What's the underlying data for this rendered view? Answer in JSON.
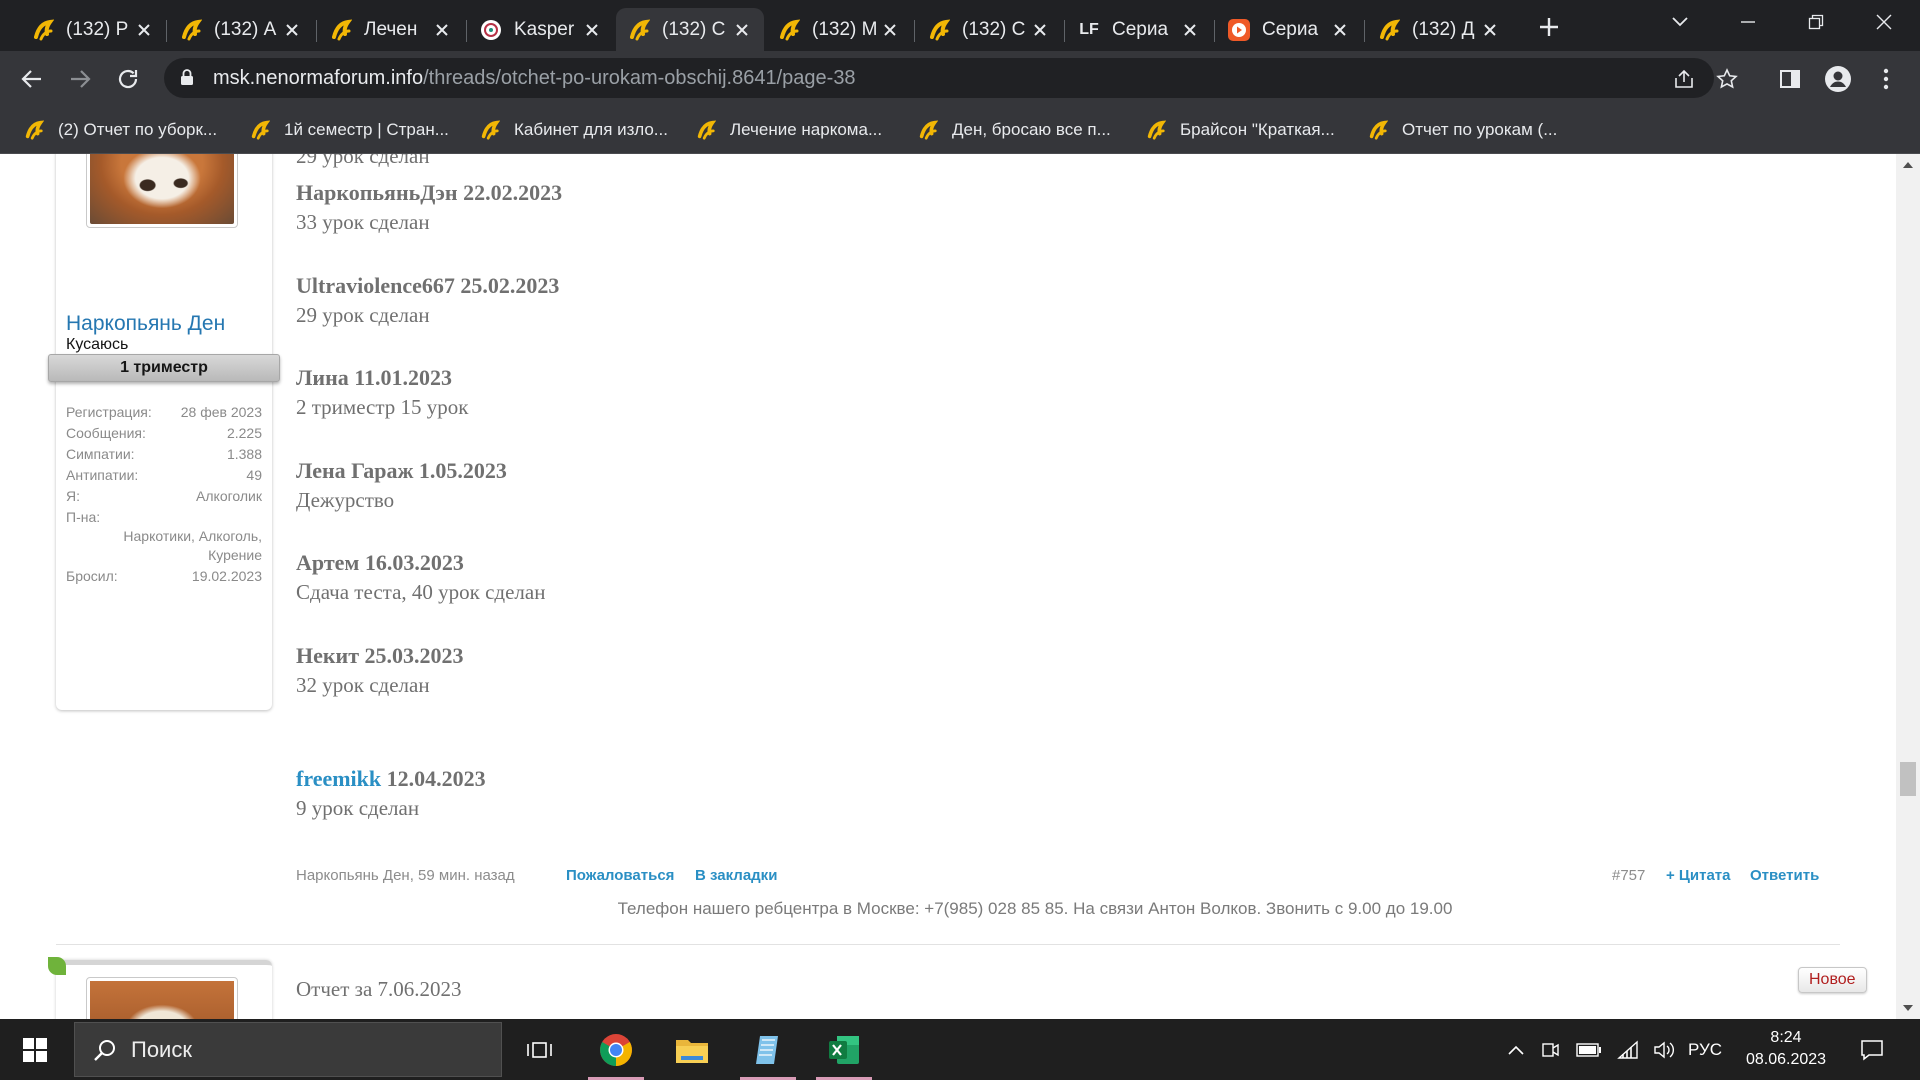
{
  "browser": {
    "tabs": [
      {
        "label": "(132) Р",
        "favicon": "forum-logo-icon",
        "active": false
      },
      {
        "label": "(132) А",
        "favicon": "forum-logo-icon",
        "active": false
      },
      {
        "label": "Лечен",
        "favicon": "forum-logo-icon",
        "active": false
      },
      {
        "label": "Kasper",
        "favicon": "kaspersky-icon",
        "active": false
      },
      {
        "label": "(132) С",
        "favicon": "forum-logo-icon",
        "active": true
      },
      {
        "label": "(132) М",
        "favicon": "forum-logo-icon",
        "active": false
      },
      {
        "label": "(132) С",
        "favicon": "forum-logo-icon",
        "active": false
      },
      {
        "label": "Сериа",
        "favicon": "lf-icon",
        "active": false
      },
      {
        "label": "Сериа",
        "favicon": "play-icon",
        "active": false
      },
      {
        "label": "(132) Д",
        "favicon": "forum-logo-icon",
        "active": false
      }
    ],
    "lf_text": "LF",
    "address": {
      "host": "msk.nenormaforum.info",
      "path": "/threads/otchet-po-urokam-obschij.8641/page-38"
    },
    "bookmarks": [
      "(2) Отчет по уборк...",
      "1й семестр | Стран...",
      "Кабинет для изло...",
      "Лечение наркома...",
      "Ден, бросаю все п...",
      "Брайсон \"Краткая...",
      "Отчет по урокам (..."
    ]
  },
  "user": {
    "name": "Наркопьянь Ден",
    "title": "Кусаюсь",
    "rank": "1 триместр",
    "stats": [
      {
        "key": "Регистрация:",
        "value": "28 фев 2023"
      },
      {
        "key": "Сообщения:",
        "value": "2.225"
      },
      {
        "key": "Симпатии:",
        "value": "1.388"
      },
      {
        "key": "Антипатии:",
        "value": "49"
      },
      {
        "key": "Я:",
        "value": "Алкоголик"
      },
      {
        "key": "П-на:",
        "value": ""
      },
      {
        "key": "",
        "value": "Наркотики, Алкоголь,"
      },
      {
        "key": "",
        "value": "Курение"
      },
      {
        "key": "Бросил:",
        "value": "19.02.2023"
      }
    ]
  },
  "post": {
    "top_line": "29 урок сделан",
    "entries": [
      {
        "name": "НаркопьяньДэн 22.02.2023",
        "text": "33 урок сделан"
      },
      {
        "name": "Ultraviolence667 25.02.2023",
        "text": "29 урок сделан"
      },
      {
        "name": "Лина 11.01.2023",
        "text": "2 триместр 15 урок"
      },
      {
        "name": "Лена Гараж 1.05.2023",
        "text": "Дежурство"
      },
      {
        "name": "Артем 16.03.2023",
        "text": "Сдача теста, 40 урок сделан"
      },
      {
        "name": "Некит 25.03.2023",
        "text": "32 урок сделан"
      }
    ],
    "last_entry": {
      "link": "freemikk",
      "date": " 12.04.2023",
      "text": "9 урок сделан"
    },
    "meta": "Наркопьянь Ден, 59 мин. назад",
    "report": "Пожаловаться",
    "bookmark": "В закладки",
    "number": "#757",
    "quote": "+ Цитата",
    "reply": "Ответить",
    "phone_line": "Телефон нашего ребцентра в Москве: +7(985) 028 85 85. На связи Антон Волков. Звонить с 9.00 до 19.00"
  },
  "next_post": {
    "text": "Отчет за 7.06.2023",
    "badge": "Новое"
  },
  "taskbar": {
    "search_placeholder": "Поиск",
    "lang": "РУС",
    "time": "8:24",
    "date": "08.06.2023"
  },
  "colors": {
    "link": "#2a8fc4",
    "username": "#2577b1",
    "new_badge_text": "#b11f1f",
    "browser_dark": "#202124",
    "browser_toolbar": "#35363a"
  }
}
